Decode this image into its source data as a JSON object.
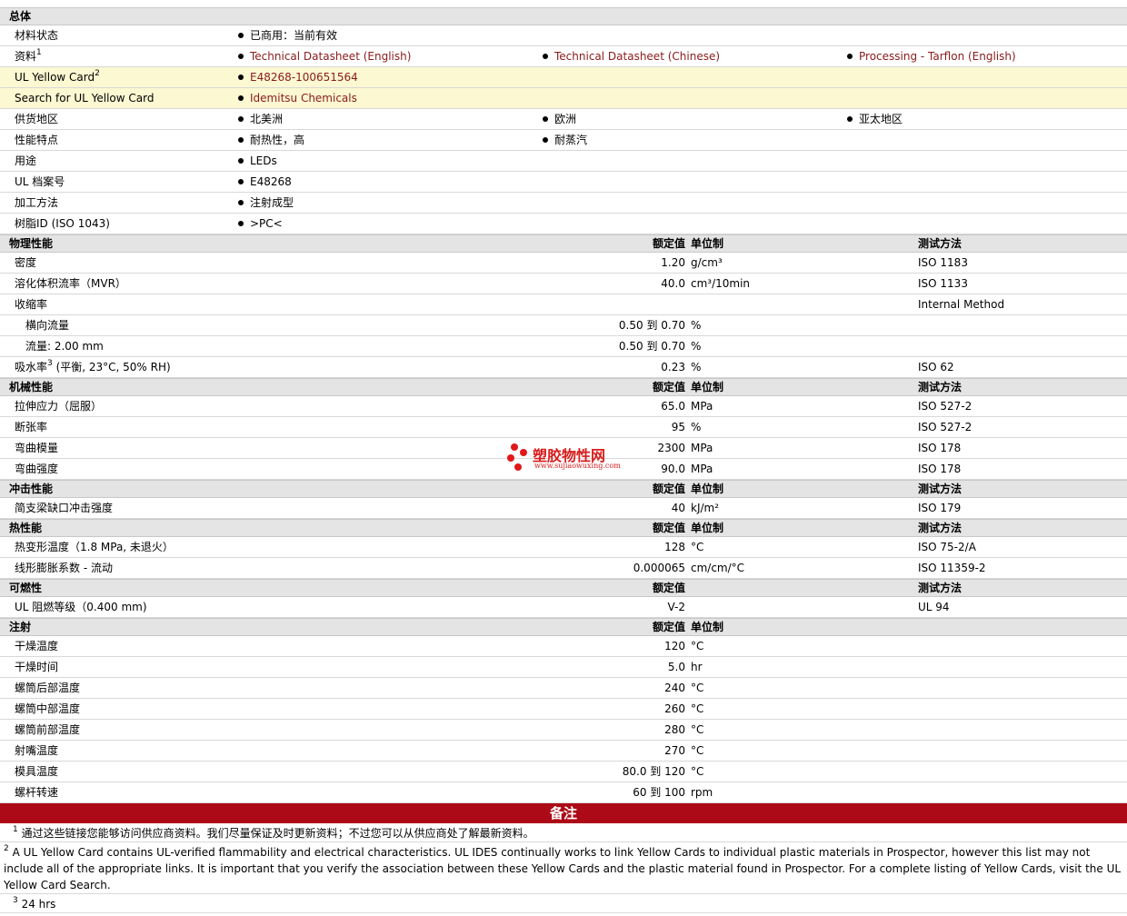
{
  "sections": [
    {
      "title": "总体",
      "type": "general",
      "rows": [
        {
          "label": "材料状态",
          "cols": [
            "已商用：当前有效"
          ]
        },
        {
          "label": "资料",
          "sup": "1",
          "links": true,
          "cols": [
            "Technical Datasheet (English)",
            "Technical Datasheet (Chinese)",
            "Processing - Tarflon (English)"
          ]
        },
        {
          "label": "UL Yellow Card",
          "sup": "2",
          "hl": true,
          "links": true,
          "cols": [
            "E48268-100651564"
          ]
        },
        {
          "label": "Search for UL Yellow Card",
          "hl": true,
          "links": true,
          "cols": [
            "Idemitsu Chemicals"
          ]
        },
        {
          "label": "供货地区",
          "cols": [
            "北美洲",
            "欧洲",
            "亚太地区"
          ]
        },
        {
          "label": "性能特点",
          "cols": [
            "耐热性，高",
            "耐蒸汽"
          ]
        },
        {
          "label": "用途",
          "cols": [
            "LEDs"
          ]
        },
        {
          "label": "UL 档案号",
          "cols": [
            "E48268"
          ]
        },
        {
          "label": "加工方法",
          "cols": [
            "注射成型"
          ]
        },
        {
          "label": "树脂ID (ISO 1043)",
          "cols": [
            ">PC<"
          ]
        }
      ]
    },
    {
      "title": "物理性能",
      "h_val": "额定值",
      "h_unit": "单位制",
      "h_meth": "测试方法",
      "rows": [
        {
          "label": "密度",
          "val": "1.20",
          "unit": "g/cm³",
          "meth": "ISO 1183"
        },
        {
          "label": "溶化体积流率（MVR）",
          "val": "40.0",
          "unit": "cm³/10min",
          "meth": "ISO 1133"
        },
        {
          "label": "收缩率",
          "val": "",
          "unit": "",
          "meth": "Internal Method"
        },
        {
          "label": "横向流量",
          "sub": true,
          "val": "0.50 到  0.70",
          "unit": "%",
          "meth": ""
        },
        {
          "label": "流量: 2.00 mm",
          "sub": true,
          "val": "0.50 到  0.70",
          "unit": "%",
          "meth": ""
        },
        {
          "label": "吸水率",
          "sup": "3",
          "label_suffix": " (平衡, 23°C, 50% RH)",
          "val": "0.23",
          "unit": "%",
          "meth": "ISO 62"
        }
      ]
    },
    {
      "title": "机械性能",
      "h_val": "额定值",
      "h_unit": "单位制",
      "h_meth": "测试方法",
      "rows": [
        {
          "label": "拉伸应力（屈服）",
          "val": "65.0",
          "unit": "MPa",
          "meth": "ISO 527-2"
        },
        {
          "label": "断张率",
          "val": "95",
          "unit": "%",
          "meth": "ISO 527-2"
        },
        {
          "label": "弯曲模量",
          "val": "2300",
          "unit": "MPa",
          "meth": "ISO 178"
        },
        {
          "label": "弯曲强度",
          "val": "90.0",
          "unit": "MPa",
          "meth": "ISO 178"
        }
      ]
    },
    {
      "title": "冲击性能",
      "h_val": "额定值",
      "h_unit": "单位制",
      "h_meth": "测试方法",
      "rows": [
        {
          "label": "简支梁缺口冲击强度",
          "val": "40",
          "unit": "kJ/m²",
          "meth": "ISO 179"
        }
      ]
    },
    {
      "title": "热性能",
      "h_val": "额定值",
      "h_unit": "单位制",
      "h_meth": "测试方法",
      "rows": [
        {
          "label": "热变形温度（1.8 MPa, 未退火）",
          "val": "128",
          "unit": "°C",
          "meth": "ISO 75-2/A"
        },
        {
          "label": "线形膨胀系数 - 流动",
          "val": "0.000065",
          "unit": "cm/cm/°C",
          "meth": "ISO 11359-2"
        }
      ]
    },
    {
      "title": "可燃性",
      "h_val": "额定值",
      "h_unit": "",
      "h_meth": "测试方法",
      "rows": [
        {
          "label": "UL 阻燃等级（0.400 mm)",
          "val": "V-2",
          "unit": "",
          "meth": "UL 94"
        }
      ]
    },
    {
      "title": "注射",
      "h_val": "额定值",
      "h_unit": "单位制",
      "h_meth": "",
      "rows": [
        {
          "label": "干燥温度",
          "val": "120",
          "unit": "°C",
          "meth": ""
        },
        {
          "label": "干燥时间",
          "val": "5.0",
          "unit": "hr",
          "meth": ""
        },
        {
          "label": "螺筒后部温度",
          "val": "240",
          "unit": "°C",
          "meth": ""
        },
        {
          "label": "螺筒中部温度",
          "val": "260",
          "unit": "°C",
          "meth": ""
        },
        {
          "label": "螺筒前部温度",
          "val": "280",
          "unit": "°C",
          "meth": ""
        },
        {
          "label": "射嘴温度",
          "val": "270",
          "unit": "°C",
          "meth": ""
        },
        {
          "label": "模具温度",
          "val": "80.0 到  120",
          "unit": "°C",
          "meth": ""
        },
        {
          "label": "螺杆转速",
          "val": "60 到  100",
          "unit": "rpm",
          "meth": ""
        }
      ]
    }
  ],
  "notes_title": "备注",
  "notes": [
    {
      "num": "1",
      "text": "通过这些链接您能够访问供应商资料。我们尽量保证及时更新资料；不过您可以从供应商处了解最新资料。"
    },
    {
      "num": "2",
      "text": "A UL Yellow Card contains UL-verified flammability and electrical characteristics. UL IDES continually works to link Yellow Cards to individual plastic materials in Prospector, however this list may not include all of the appropriate links. It is important that you verify the association between these Yellow Cards and the plastic material found in Prospector. For a complete listing of Yellow Cards, visit the UL Yellow Card Search."
    },
    {
      "num": "3",
      "text": "24 hrs"
    }
  ],
  "watermark": {
    "title": "塑胶物性网",
    "url": "www.sujiaowuxing.com"
  },
  "colors": {
    "link": "#8b1a1a",
    "notes_bar": "#ad0a17",
    "highlight": "#fbf8d2",
    "section": "#e4e4e4"
  }
}
